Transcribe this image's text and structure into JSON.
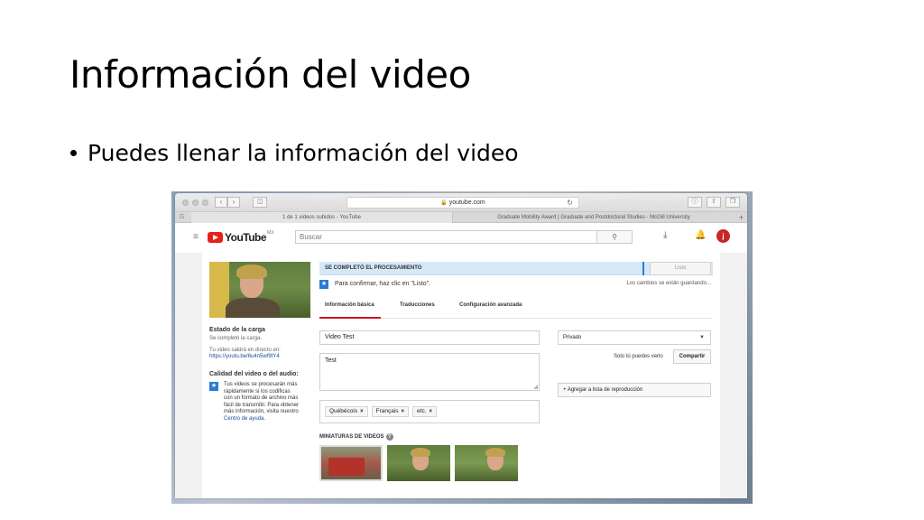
{
  "slide": {
    "title": "Información del video",
    "bullet": "Puedes llenar la información del video"
  },
  "browser": {
    "url": "youtube.com",
    "tabs": [
      "1 de 1 videos subidos - YouTube",
      "Graduate Mobility Award | Graduate and Postdoctoral Studies - McGill University"
    ],
    "tab_g": "G",
    "tab_plus": "+"
  },
  "youtube": {
    "logo_text": "YouTube",
    "region": "MX",
    "search_placeholder": "Buscar",
    "avatar_initial": "j"
  },
  "left": {
    "status_heading": "Estado de la carga",
    "status_text": "Se completó la carga.",
    "live_text": "Tu video saldrá en directo en:",
    "video_link": "https://youtu.be/6u4n5wf9tY4",
    "quality_heading": "Calidad del video o del audio:",
    "quality_text": "Tus videos se procesarán más rápidamente si los codificas con un formato de archivo más fácil de transmitir. Para obtener más información, visita nuestro",
    "help_link": "Centro de ayuda."
  },
  "upload": {
    "banner": "SE COMPLETÓ EL PROCESAMIENTO",
    "listo_label": "Listo",
    "confirm_text": "Para confirmar, haz clic en \"Listo\".",
    "saving_text": "Los cambios se están guardando...",
    "tabs": [
      "Información básica",
      "Traducciones",
      "Configuración avanzada"
    ]
  },
  "form": {
    "title_value": "Video Test",
    "description_value": "Test",
    "tags": [
      "Québécois",
      "Français",
      "etc."
    ],
    "thumbnails_heading": "MINIATURAS DE VIDEOS",
    "privacy_value": "Privado",
    "share_note": "Solo tú puedes verlo",
    "share_label": "Compartir",
    "playlist_label": "+ Agregar a lista de reproducción"
  }
}
